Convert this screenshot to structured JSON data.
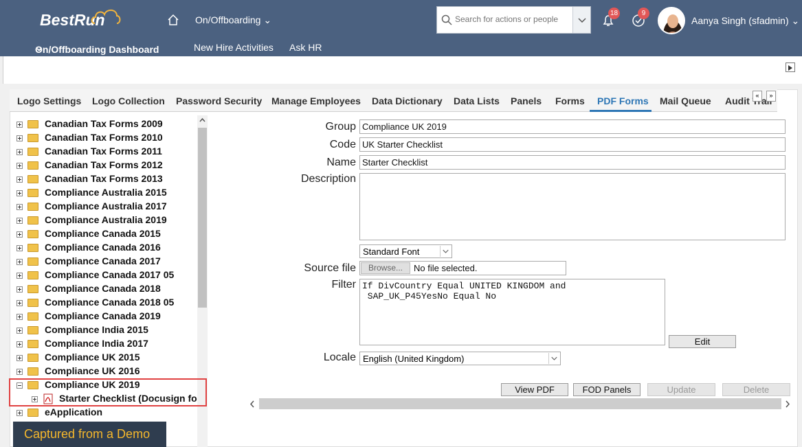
{
  "header": {
    "logo": "BestRun",
    "module_menu": "On/Offboarding",
    "search_placeholder": "Search for actions or people",
    "notifications_count": "18",
    "approvals_count": "9",
    "user_name": "Aanya Singh (sfadmin)"
  },
  "subnav": {
    "dashboard": "On/Offboarding Dashboard",
    "new_hire": "New Hire Activities",
    "ask_hr": "Ask HR"
  },
  "tabs": [
    "Logo Settings",
    "Logo Collection",
    "Password Security",
    "Manage Employees",
    "Data Dictionary",
    "Data Lists",
    "Panels",
    "Forms",
    "PDF Forms",
    "Mail Queue",
    "Audit Trail"
  ],
  "tab_scroll": {
    "left": "«",
    "right": "»"
  },
  "tree": [
    {
      "label": "Canadian Tax Forms 2009",
      "type": "folder",
      "expanded": false
    },
    {
      "label": "Canadian Tax Forms 2010",
      "type": "folder",
      "expanded": false
    },
    {
      "label": "Canadian Tax Forms 2011",
      "type": "folder",
      "expanded": false
    },
    {
      "label": "Canadian Tax Forms 2012",
      "type": "folder",
      "expanded": false
    },
    {
      "label": "Canadian Tax Forms 2013",
      "type": "folder",
      "expanded": false
    },
    {
      "label": "Compliance Australia 2015",
      "type": "folder",
      "expanded": false
    },
    {
      "label": "Compliance Australia 2017",
      "type": "folder",
      "expanded": false
    },
    {
      "label": "Compliance Australia 2019",
      "type": "folder",
      "expanded": false
    },
    {
      "label": "Compliance Canada 2015",
      "type": "folder",
      "expanded": false
    },
    {
      "label": "Compliance Canada 2016",
      "type": "folder",
      "expanded": false
    },
    {
      "label": "Compliance Canada 2017",
      "type": "folder",
      "expanded": false
    },
    {
      "label": "Compliance Canada 2017 05",
      "type": "folder",
      "expanded": false
    },
    {
      "label": "Compliance Canada 2018",
      "type": "folder",
      "expanded": false
    },
    {
      "label": "Compliance Canada 2018 05",
      "type": "folder",
      "expanded": false
    },
    {
      "label": "Compliance Canada 2019",
      "type": "folder",
      "expanded": false
    },
    {
      "label": "Compliance India 2015",
      "type": "folder",
      "expanded": false
    },
    {
      "label": "Compliance India 2017",
      "type": "folder",
      "expanded": false
    },
    {
      "label": "Compliance UK 2015",
      "type": "folder",
      "expanded": false
    },
    {
      "label": "Compliance UK 2016",
      "type": "folder",
      "expanded": false
    },
    {
      "label": "Compliance UK 2019",
      "type": "folder",
      "expanded": true
    },
    {
      "label": "Starter Checklist (Docusign form",
      "type": "pdf",
      "expanded": false
    },
    {
      "label": "eApplication",
      "type": "folder",
      "expanded": false
    }
  ],
  "demo_banner": "Captured from a Demo",
  "form": {
    "group_label": "Group",
    "group_value": "Compliance UK 2019",
    "code_label": "Code",
    "code_value": "UK Starter Checklist",
    "name_label": "Name",
    "name_value": "Starter Checklist",
    "description_label": "Description",
    "description_value": "",
    "font_value": "Standard Font",
    "source_label": "Source file",
    "browse_label": "Browse...",
    "no_file": "No file selected.",
    "filter_label": "Filter",
    "filter_value": "If DivCountry Equal UNITED KINGDOM and\n SAP_UK_P45YesNo Equal No",
    "edit_label": "Edit",
    "locale_label": "Locale",
    "locale_value": "English (United Kingdom)"
  },
  "actions": {
    "view_pdf": "View PDF",
    "fod_panels": "FOD Panels",
    "update": "Update",
    "delete": "Delete"
  },
  "colors": {
    "shell": "#4b6180",
    "accent": "#2d76b5",
    "badge": "#e25757",
    "highlight": "#e04141"
  }
}
